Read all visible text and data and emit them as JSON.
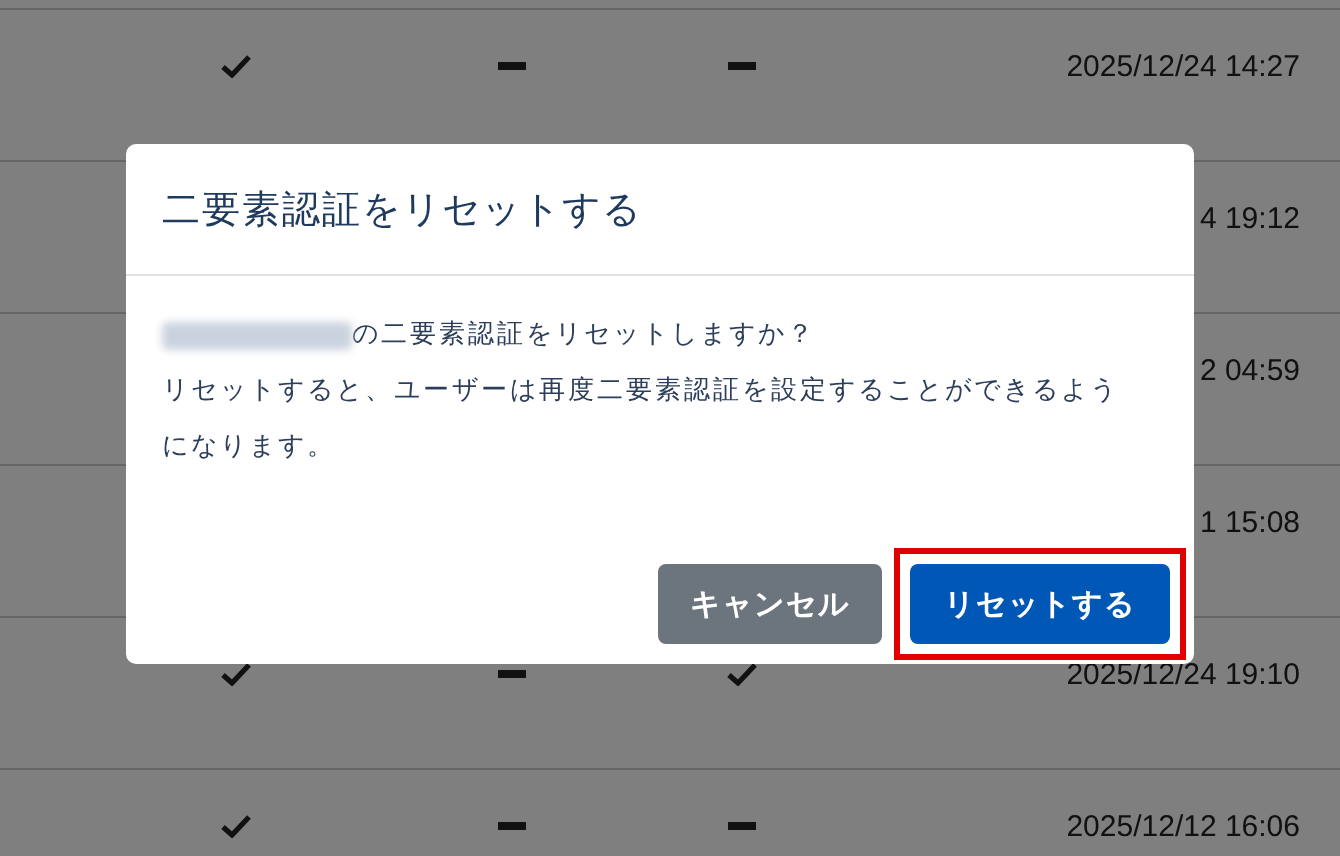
{
  "table": {
    "rows": [
      {
        "cells": [
          {
            "kind": "check"
          },
          {
            "kind": "dash"
          },
          {
            "kind": "dash"
          }
        ],
        "date": "2025/12/24 14:27"
      },
      {
        "cells": [],
        "date": "4 19:12"
      },
      {
        "cells": [],
        "date": "2 04:59"
      },
      {
        "cells": [],
        "date": "1 15:08"
      },
      {
        "cells": [
          {
            "kind": "check"
          },
          {
            "kind": "dash"
          },
          {
            "kind": "check"
          }
        ],
        "date": "2025/12/24 19:10"
      },
      {
        "cells": [
          {
            "kind": "check"
          },
          {
            "kind": "dash"
          },
          {
            "kind": "dash"
          }
        ],
        "date": "2025/12/12 16:06"
      }
    ]
  },
  "dialog": {
    "title": "二要素認証をリセットする",
    "name_redacted": true,
    "question": "の二要素認証をリセットしますか？",
    "message": "リセットすると、ユーザーは再度二要素認証を設定することができるようになります。",
    "buttons": [
      {
        "kind": "secondary",
        "label": "キャンセル",
        "highlighted": false
      },
      {
        "kind": "primary",
        "label": "リセットする",
        "highlighted": true
      }
    ]
  }
}
